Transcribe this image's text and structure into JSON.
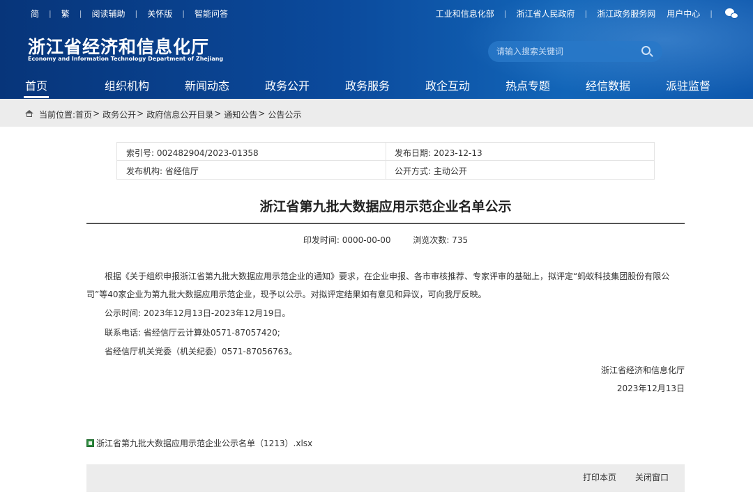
{
  "topbar": {
    "left": [
      "简",
      "繁",
      "阅读辅助",
      "关怀版",
      "智能问答"
    ],
    "right": [
      "工业和信息化部",
      "浙江省人民政府",
      "浙江政务服务网"
    ],
    "user_center": "用户中心",
    "wechat_icon": "wechat-icon"
  },
  "header": {
    "logo_cn": "浙江省经济和信息化厅",
    "logo_en": "Economy and Information Technology Department of Zhejiang",
    "search_placeholder": "请输入搜索关键词"
  },
  "nav": {
    "items": [
      "首页",
      "组织机构",
      "新闻动态",
      "政务公开",
      "政务服务",
      "政企互动",
      "热点专题",
      "经信数据",
      "派驻监督"
    ],
    "active": "首页"
  },
  "breadcrumb": {
    "prefix": "当前位置:",
    "items": [
      "首页",
      "政务公开",
      "政府信息公开目录",
      "通知公告",
      "公告公示"
    ]
  },
  "meta": {
    "index_no": "索引号: 002482904/2023-01358",
    "publish_date": "发布日期: 2023-12-13",
    "publisher": "发布机构: 省经信厅",
    "open_mode": "公开方式: 主动公开"
  },
  "article": {
    "title": "浙江省第九批大数据应用示范企业名单公示",
    "print_time": "印发时间: 0000-00-00",
    "views": "浏览次数: 735",
    "para1": "根据《关于组织申报浙江省第九批大数据应用示范企业的通知》要求，在企业申报、各市审核推荐、专家评审的基础上，拟评定“蚂蚁科技集团股份有限公司”等40家企业为第九批大数据应用示范企业，现予以公示。对拟评定结果如有意见和异议，可向我厅反映。",
    "period": "公示时间: 2023年12月13日-2023年12月19日。",
    "contact1": "联系电话: 省经信厅云计算处0571-87057420;",
    "contact2": "省经信厅机关党委（机关纪委）0571-87056763。",
    "sign_org": "浙江省经济和信息化厅",
    "sign_date": "2023年12月13日",
    "attachment": "浙江省第九批大数据应用示范企业公示名单（1213）.xlsx"
  },
  "footer": {
    "print": "打印本页",
    "close": "关闭窗口"
  }
}
